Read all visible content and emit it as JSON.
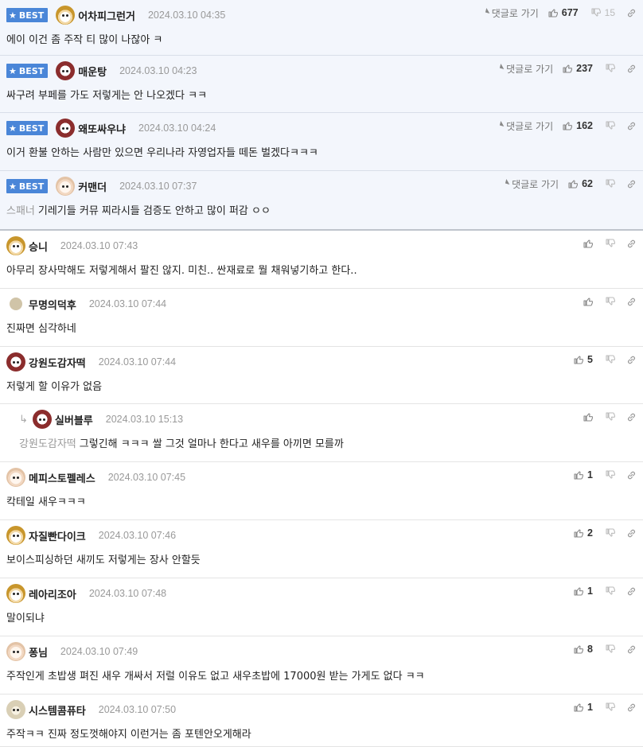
{
  "ui": {
    "best_label": "BEST",
    "reply_to_label": "댓글로 가기"
  },
  "comments": [
    {
      "best": true,
      "avatar": "fox",
      "nick": "어차피그런거",
      "date": "2024.03.10 04:35",
      "text": "에이 이건 좀 주작 티 많이 나잖아 ㅋ",
      "mention": "",
      "up": "677",
      "down": "15",
      "reply": false
    },
    {
      "best": true,
      "avatar": "red",
      "nick": "매운탕",
      "date": "2024.03.10 04:23",
      "text": "싸구려 부페를 가도 저렇게는 안 나오겠다 ㅋㅋ",
      "mention": "",
      "up": "237",
      "down": "",
      "reply": false
    },
    {
      "best": true,
      "avatar": "red",
      "nick": "왜또싸우냐",
      "date": "2024.03.10 04:24",
      "text": "이거 환불 안하는 사람만 있으면 우리나라 자영업자들 떼돈 벌겠다ㅋㅋㅋ",
      "mention": "",
      "up": "162",
      "down": "",
      "reply": false
    },
    {
      "best": true,
      "avatar": "dog",
      "nick": "커맨더",
      "date": "2024.03.10 07:37",
      "text": "기레기들 커뮤 찌라시들 검증도 안하고 많이 퍼감 ㅇㅇ",
      "mention": "스패너",
      "up": "62",
      "down": "",
      "reply": false
    },
    {
      "best": false,
      "avatar": "fox",
      "nick": "승니",
      "date": "2024.03.10 07:43",
      "text": "아무리 장사막해도 저렇게해서 팔진 않지. 미친.. 싼재료로 뭘 채워넣기하고 한다..",
      "mention": "",
      "up": "",
      "down": "",
      "reply": false
    },
    {
      "best": false,
      "avatar": "blank",
      "nick": "무명의덕후",
      "date": "2024.03.10 07:44",
      "text": "진짜면 심각하네",
      "mention": "",
      "up": "",
      "down": "",
      "reply": false
    },
    {
      "best": false,
      "avatar": "red",
      "nick": "강원도감자떡",
      "date": "2024.03.10 07:44",
      "text": "저렇게 할 이유가 없음",
      "mention": "",
      "up": "5",
      "down": "",
      "reply": false
    },
    {
      "best": false,
      "avatar": "red",
      "nick": "실버블루",
      "date": "2024.03.10 15:13",
      "text": "그렇긴해 ㅋㅋㅋ 쌀 그것 얼마나 한다고 새우를 아끼면 모를까",
      "mention": "강원도감자떡",
      "up": "",
      "down": "",
      "reply": true
    },
    {
      "best": false,
      "avatar": "dog",
      "nick": "메피스토펠레스",
      "date": "2024.03.10 07:45",
      "text": "칵테일 새우ㅋㅋㅋ",
      "mention": "",
      "up": "1",
      "down": "",
      "reply": false
    },
    {
      "best": false,
      "avatar": "fox",
      "nick": "자질빤다이크",
      "date": "2024.03.10 07:46",
      "text": "보이스피싱하던 새끼도 저렇게는 장사 안할듯",
      "mention": "",
      "up": "2",
      "down": "",
      "reply": false
    },
    {
      "best": false,
      "avatar": "fox",
      "nick": "레아리조아",
      "date": "2024.03.10 07:48",
      "text": "말이되냐",
      "mention": "",
      "up": "1",
      "down": "",
      "reply": false
    },
    {
      "best": false,
      "avatar": "dog",
      "nick": "퐁님",
      "date": "2024.03.10 07:49",
      "text": "주작인게 초밥생 펴진 새우 개싸서 저럴 이유도 없고 새우초밥에 17000원 받는 가게도 없다 ㅋㅋ",
      "mention": "",
      "up": "8",
      "down": "",
      "reply": false
    },
    {
      "best": false,
      "avatar": "sys",
      "nick": "시스템콤퓨타",
      "date": "2024.03.10 07:50",
      "text": "주작ㅋㅋ 진짜 정도껏해야지 이런거는 좀 포텐안오게해라",
      "mention": "",
      "up": "1",
      "down": "",
      "reply": false
    }
  ]
}
